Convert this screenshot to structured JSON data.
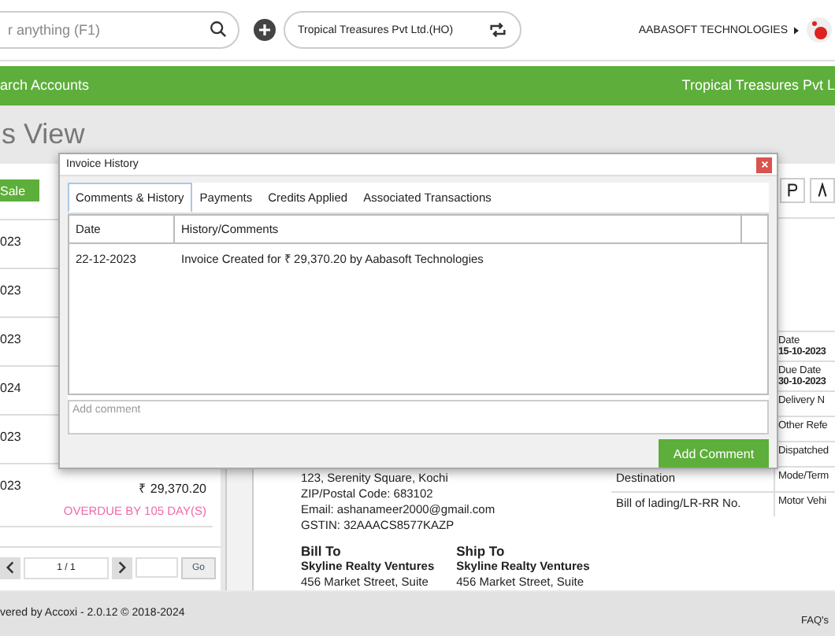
{
  "topbar": {
    "search": {
      "placeholder": "r anything (F1)"
    },
    "company": "Tropical Treasures Pvt Ltd.(HO)",
    "user": "AABASOFT TECHNOLOGIES"
  },
  "navbar": {
    "left": "arch Accounts",
    "right": "Tropical Treasures Pvt L"
  },
  "page_title": "s View",
  "list": {
    "button": "Sale",
    "rows": [
      {
        "date": "023"
      },
      {
        "date": "023"
      },
      {
        "date": "023"
      },
      {
        "date": "024"
      },
      {
        "date": "023"
      }
    ],
    "last": {
      "date": "023",
      "amount": "₹ 29,370.20",
      "status": "OVERDUE BY 105 DAY(S)"
    },
    "pager": {
      "value": "1 / 1",
      "go": "Go"
    }
  },
  "invoice": {
    "address": [
      "123, Serenity Square, Kochi",
      "ZIP/Postal Code: 683102",
      "Email: ashanameer2000@gmail.com",
      "GSTIN: 32AAACS8577KAZP"
    ],
    "parties": [
      {
        "label": "Bill To",
        "name": "Skyline Realty Ventures",
        "line": "456 Market Street, Suite"
      },
      {
        "label": "Ship To",
        "name": "Skyline Realty Ventures",
        "line": "456 Market Street, Suite"
      }
    ],
    "details": [
      {
        "label": "Date",
        "value": "15-10-2023"
      },
      {
        "label": "Due Date",
        "value": "30-10-2023"
      },
      {
        "label": "Delivery N"
      },
      {
        "label": "Other Refe"
      },
      {
        "label": "Dispatched"
      }
    ],
    "transport": [
      {
        "left": "Destination",
        "right": "Mode/Term"
      },
      {
        "left": "Bill of lading/LR-RR No.",
        "right": "Motor Vehi"
      }
    ]
  },
  "footer": {
    "text": "vered by Accoxi - 2.0.12 © 2018-2024",
    "faq": "FAQ's"
  },
  "dialog": {
    "title": "Invoice History",
    "tabs": [
      {
        "label": "Comments & History",
        "selected": true
      },
      {
        "label": "Payments",
        "selected": false
      },
      {
        "label": "Credits Applied",
        "selected": false
      },
      {
        "label": "Associated Transactions",
        "selected": false
      }
    ],
    "columns": [
      "Date",
      "History/Comments"
    ],
    "rows": [
      {
        "date": "22-12-2023",
        "comment": "Invoice Created for ₹ 29,370.20 by Aabasoft Technologies"
      }
    ],
    "comment": {
      "placeholder": "Add comment"
    },
    "button": "Add Comment"
  }
}
